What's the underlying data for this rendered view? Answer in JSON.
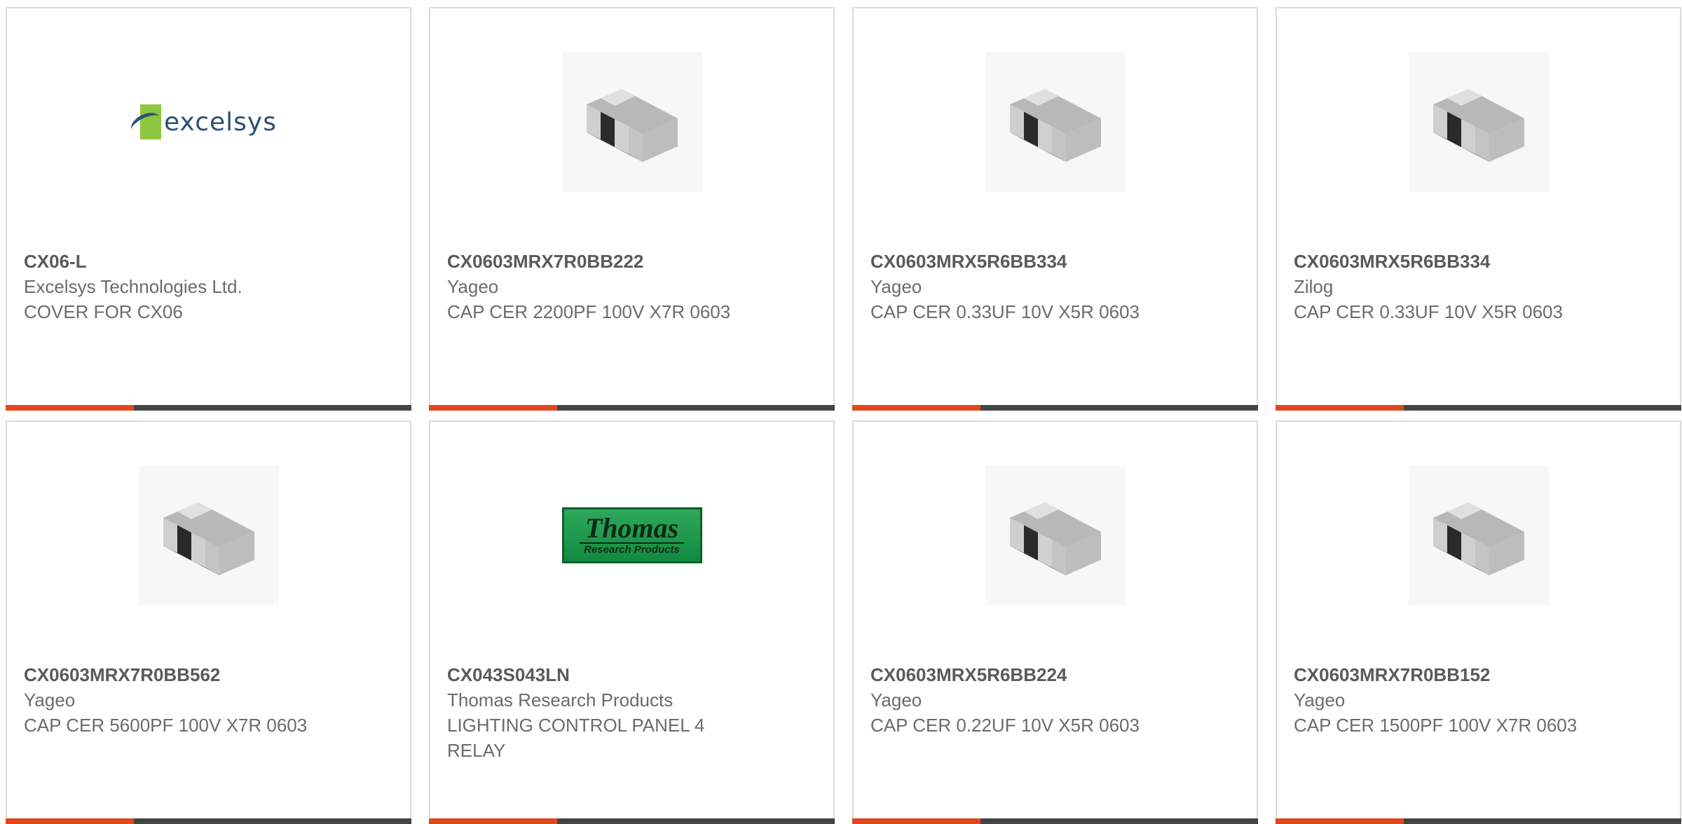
{
  "colors": {
    "accent": "#e0481c",
    "bar": "#444444",
    "text": "#6b6b6b",
    "border": "#dcdcdc"
  },
  "cards": [
    {
      "image": "excelsys-logo",
      "logo_text": "excelsys",
      "part_number": "CX06-L",
      "manufacturer": "Excelsys Technologies Ltd.",
      "description": "COVER FOR CX06"
    },
    {
      "image": "smd-capacitor-icon",
      "part_number": "CX0603MRX7R0BB222",
      "manufacturer": "Yageo",
      "description": "CAP CER 2200PF 100V X7R 0603"
    },
    {
      "image": "smd-capacitor-icon",
      "part_number": "CX0603MRX5R6BB334",
      "manufacturer": "Yageo",
      "description": "CAP CER 0.33UF 10V X5R 0603"
    },
    {
      "image": "smd-capacitor-icon",
      "part_number": "CX0603MRX5R6BB334",
      "manufacturer": "Zilog",
      "description": "CAP CER 0.33UF 10V X5R 0603"
    },
    {
      "image": "smd-capacitor-icon",
      "part_number": "CX0603MRX7R0BB562",
      "manufacturer": "Yageo",
      "description": "CAP CER 5600PF 100V X7R 0603"
    },
    {
      "image": "thomas-logo",
      "logo_text": "Thomas",
      "logo_subtext": "Research Products",
      "part_number": "CX043S043LN",
      "manufacturer": "Thomas Research Products",
      "description": "LIGHTING CONTROL PANEL 4 RELAY"
    },
    {
      "image": "smd-capacitor-icon",
      "part_number": "CX0603MRX5R6BB224",
      "manufacturer": "Yageo",
      "description": "CAP CER 0.22UF 10V X5R 0603"
    },
    {
      "image": "smd-capacitor-icon",
      "part_number": "CX0603MRX7R0BB152",
      "manufacturer": "Yageo",
      "description": "CAP CER 1500PF 100V X7R 0603"
    }
  ]
}
